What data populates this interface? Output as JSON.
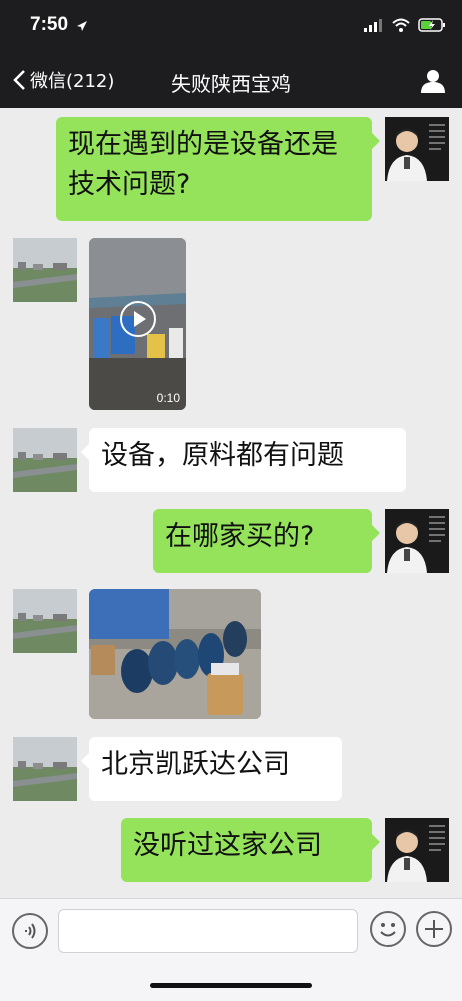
{
  "status": {
    "time": "7:50"
  },
  "nav": {
    "back_label": "微信(212)",
    "title": "失败陕西宝鸡"
  },
  "messages": [
    {
      "text": "现在遇到的是设备还是技术问题?"
    },
    {
      "duration": "0:10"
    },
    {
      "text": "设备，原料都有问题"
    },
    {
      "text": "在哪家买的?"
    },
    {
      "text": "北京凯跃达公司"
    },
    {
      "text": "没听过这家公司"
    }
  ],
  "colors": {
    "self_bubble": "#95e35b",
    "other_bubble": "#ffffff",
    "topbar": "#1d1d1f",
    "chat_bg": "#ececec"
  },
  "icons": [
    "back-chevron-icon",
    "person-icon",
    "voice-icon",
    "emoji-icon",
    "plus-icon",
    "play-icon",
    "location-arrow-icon",
    "signal-icon",
    "wifi-icon",
    "battery-icon"
  ]
}
